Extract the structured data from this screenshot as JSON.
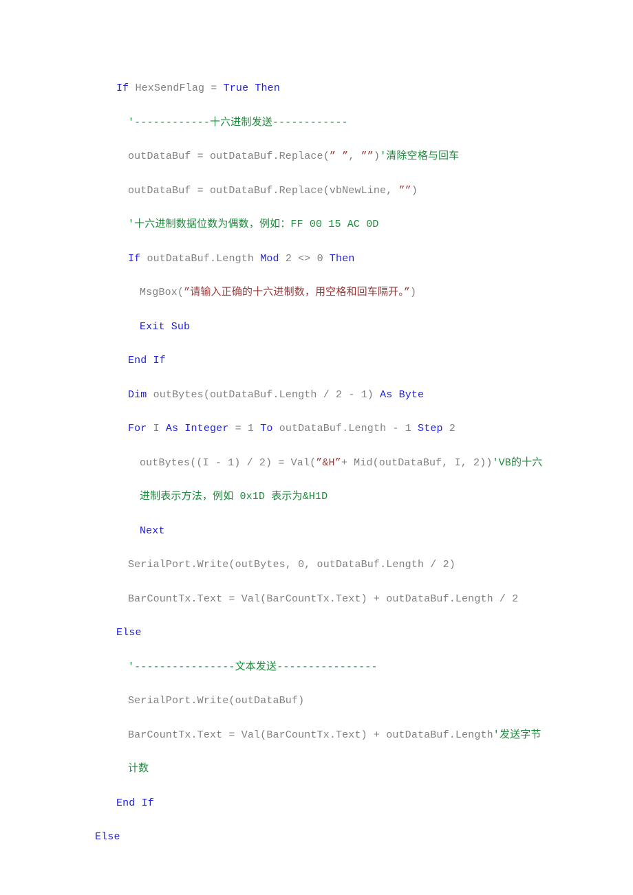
{
  "document": {
    "type": "source-code-listing",
    "language": "VB.NET",
    "background_color": "#ffffff",
    "syntax_colors": {
      "keyword": "#2222dd",
      "identifier": "#808080",
      "string": "#9c3838",
      "comment": "#1e8a3c",
      "number": "#808080",
      "operator": "#808080"
    }
  },
  "code": {
    "lines": [
      {
        "id": "line-if-hexsendflag",
        "indent": 1,
        "tokens": [
          {
            "t": "kw",
            "v": "If "
          },
          {
            "t": "id",
            "v": "HexSendFlag "
          },
          {
            "t": "op",
            "v": "= "
          },
          {
            "t": "kw",
            "v": "True Then"
          }
        ]
      },
      {
        "id": "line-comment-hex-send",
        "indent": 2,
        "tokens": [
          {
            "t": "cmt",
            "v": "'------------十六进制发送------------"
          }
        ]
      },
      {
        "id": "line-replace-space",
        "indent": 2,
        "tokens": [
          {
            "t": "id",
            "v": "outDataBuf = outDataBuf.Replace("
          },
          {
            "t": "str",
            "v": "” ”"
          },
          {
            "t": "id",
            "v": ", "
          },
          {
            "t": "str",
            "v": "””"
          },
          {
            "t": "id",
            "v": ")"
          },
          {
            "t": "cmt",
            "v": "'清除空格与回车"
          }
        ]
      },
      {
        "id": "line-replace-newline",
        "indent": 2,
        "tokens": [
          {
            "t": "id",
            "v": "outDataBuf = outDataBuf.Replace(vbNewLine, "
          },
          {
            "t": "str",
            "v": "””"
          },
          {
            "t": "id",
            "v": ")"
          }
        ]
      },
      {
        "id": "line-comment-even-digits",
        "indent": 2,
        "tokens": [
          {
            "t": "cmt",
            "v": "'十六进制数据位数为偶数，例如：FF 00 15 AC 0D"
          }
        ]
      },
      {
        "id": "line-if-mod",
        "indent": 2,
        "tokens": [
          {
            "t": "kw",
            "v": "If "
          },
          {
            "t": "id",
            "v": "outDataBuf.Length "
          },
          {
            "t": "kw",
            "v": "Mod "
          },
          {
            "t": "num",
            "v": "2 "
          },
          {
            "t": "op",
            "v": "<> "
          },
          {
            "t": "num",
            "v": "0 "
          },
          {
            "t": "kw",
            "v": "Then"
          }
        ]
      },
      {
        "id": "line-msgbox",
        "indent": 3,
        "tokens": [
          {
            "t": "id",
            "v": "MsgBox("
          },
          {
            "t": "str",
            "v": "”请输入正确的十六进制数，用空格和回车隔开。”"
          },
          {
            "t": "id",
            "v": ")"
          }
        ]
      },
      {
        "id": "line-exit-sub",
        "indent": 3,
        "tokens": [
          {
            "t": "kw",
            "v": "Exit Sub"
          }
        ]
      },
      {
        "id": "line-end-if-inner",
        "indent": 2,
        "tokens": [
          {
            "t": "kw",
            "v": "End If"
          }
        ]
      },
      {
        "id": "line-dim-outbytes",
        "indent": 2,
        "tokens": [
          {
            "t": "kw",
            "v": "Dim "
          },
          {
            "t": "id",
            "v": "outBytes(outDataBuf.Length / "
          },
          {
            "t": "num",
            "v": "2 "
          },
          {
            "t": "op",
            "v": "- "
          },
          {
            "t": "num",
            "v": "1"
          },
          {
            "t": "id",
            "v": ") "
          },
          {
            "t": "kw",
            "v": "As Byte"
          }
        ]
      },
      {
        "id": "line-for-loop",
        "indent": 2,
        "tokens": [
          {
            "t": "kw",
            "v": "For "
          },
          {
            "t": "id",
            "v": "I "
          },
          {
            "t": "kw",
            "v": "As Integer "
          },
          {
            "t": "op",
            "v": "= "
          },
          {
            "t": "num",
            "v": "1 "
          },
          {
            "t": "kw",
            "v": "To "
          },
          {
            "t": "id",
            "v": "outDataBuf.Length "
          },
          {
            "t": "op",
            "v": "- "
          },
          {
            "t": "num",
            "v": "1 "
          },
          {
            "t": "kw",
            "v": "Step "
          },
          {
            "t": "num",
            "v": "2"
          }
        ]
      },
      {
        "id": "line-outbytes-assign",
        "indent": 3,
        "tokens": [
          {
            "t": "id",
            "v": "outBytes((I - 1) / 2) = Val("
          },
          {
            "t": "str",
            "v": "”&H”"
          },
          {
            "t": "id",
            "v": "+ Mid(outDataBuf, I, 2))"
          },
          {
            "t": "cmt",
            "v": "'VB的十六进制表示方法，例如 0x1D 表示为&H1D"
          }
        ]
      },
      {
        "id": "line-next",
        "indent": 3,
        "tokens": [
          {
            "t": "kw",
            "v": "Next"
          }
        ]
      },
      {
        "id": "line-serialport-write-bytes",
        "indent": 2,
        "tokens": [
          {
            "t": "id",
            "v": "SerialPort.Write(outBytes, "
          },
          {
            "t": "num",
            "v": "0"
          },
          {
            "t": "id",
            "v": ", outDataBuf.Length / "
          },
          {
            "t": "num",
            "v": "2"
          },
          {
            "t": "id",
            "v": ")"
          }
        ]
      },
      {
        "id": "line-barcounttx-hex",
        "indent": 2,
        "tokens": [
          {
            "t": "id",
            "v": "BarCountTx.Text = Val(BarCountTx.Text) + outDataBuf.Length / "
          },
          {
            "t": "num",
            "v": "2"
          }
        ]
      },
      {
        "id": "line-else-inner",
        "indent": 1,
        "tokens": [
          {
            "t": "kw",
            "v": "Else"
          }
        ]
      },
      {
        "id": "line-comment-text-send",
        "indent": 2,
        "tokens": [
          {
            "t": "cmt",
            "v": "'----------------文本发送----------------"
          }
        ]
      },
      {
        "id": "line-serialport-write-text",
        "indent": 2,
        "tokens": [
          {
            "t": "id",
            "v": "SerialPort.Write(outDataBuf)"
          }
        ]
      },
      {
        "id": "line-barcounttx-text",
        "indent": 2,
        "tokens": [
          {
            "t": "id",
            "v": "BarCountTx.Text = Val(BarCountTx.Text) + outDataBuf.Length"
          },
          {
            "t": "cmt",
            "v": "'发送字节计数"
          }
        ]
      },
      {
        "id": "line-end-if-outer",
        "indent": 1,
        "tokens": [
          {
            "t": "kw",
            "v": "End If"
          }
        ]
      },
      {
        "id": "line-else-outer",
        "indent": 0,
        "tokens": [
          {
            "t": "kw",
            "v": "Else"
          }
        ]
      }
    ]
  }
}
